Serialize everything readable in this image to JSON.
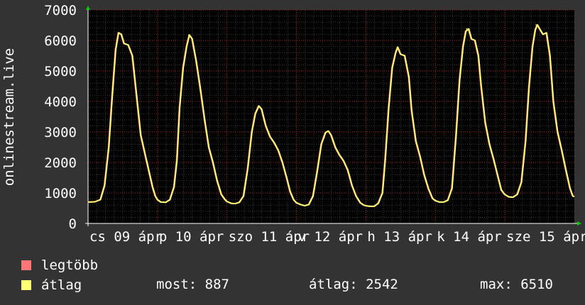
{
  "chart_data": {
    "type": "line",
    "ylabel": "onlinestream.live",
    "ylim": [
      0,
      7000
    ],
    "yticks": [
      0,
      1000,
      2000,
      3000,
      4000,
      5000,
      6000,
      7000
    ],
    "xlim": [
      0,
      7
    ],
    "xticks": [
      {
        "x": 0,
        "label": "cs 09 ápr"
      },
      {
        "x": 1,
        "label": "p 10 ápr"
      },
      {
        "x": 2,
        "label": "szo 11 ápr"
      },
      {
        "x": 3,
        "label": "v 12 ápr"
      },
      {
        "x": 4,
        "label": "h 13 ápr"
      },
      {
        "x": 5,
        "label": "k 14 ápr"
      },
      {
        "x": 6,
        "label": "sze 15 ápr"
      }
    ],
    "grid": true,
    "background": "#000000",
    "colors": {
      "max": "#ff7777",
      "avg": "#ffff77",
      "grid_major": "#9b2d2d",
      "grid_minor": "#3a3a3a",
      "arrow": "#00cc00"
    },
    "daily_peaks": [
      {
        "x": 0.45,
        "y": 6250
      },
      {
        "x": 1.45,
        "y": 6180
      },
      {
        "x": 2.45,
        "y": 3850
      },
      {
        "x": 3.45,
        "y": 3030
      },
      {
        "x": 4.45,
        "y": 5780
      },
      {
        "x": 5.45,
        "y": 6380
      },
      {
        "x": 6.45,
        "y": 6510
      }
    ],
    "series": [
      {
        "name": "legtöbb",
        "points": [
          [
            0.0,
            700
          ],
          [
            0.1,
            710
          ],
          [
            0.18,
            780
          ],
          [
            0.24,
            1250
          ],
          [
            0.3,
            2500
          ],
          [
            0.35,
            4200
          ],
          [
            0.4,
            5700
          ],
          [
            0.44,
            6250
          ],
          [
            0.48,
            6200
          ],
          [
            0.52,
            5900
          ],
          [
            0.58,
            5850
          ],
          [
            0.64,
            5500
          ],
          [
            0.7,
            4200
          ],
          [
            0.76,
            2900
          ],
          [
            0.82,
            2300
          ],
          [
            0.88,
            1700
          ],
          [
            0.93,
            1200
          ],
          [
            0.97,
            900
          ],
          [
            1.0,
            780
          ],
          [
            1.05,
            700
          ],
          [
            1.12,
            690
          ],
          [
            1.18,
            780
          ],
          [
            1.24,
            1200
          ],
          [
            1.28,
            2050
          ],
          [
            1.32,
            3800
          ],
          [
            1.37,
            5100
          ],
          [
            1.42,
            5800
          ],
          [
            1.46,
            6180
          ],
          [
            1.5,
            6050
          ],
          [
            1.56,
            5300
          ],
          [
            1.62,
            4400
          ],
          [
            1.68,
            3400
          ],
          [
            1.74,
            2500
          ],
          [
            1.8,
            2000
          ],
          [
            1.86,
            1400
          ],
          [
            1.92,
            950
          ],
          [
            1.97,
            790
          ],
          [
            2.0,
            720
          ],
          [
            2.06,
            660
          ],
          [
            2.12,
            650
          ],
          [
            2.18,
            690
          ],
          [
            2.24,
            900
          ],
          [
            2.3,
            1800
          ],
          [
            2.36,
            3000
          ],
          [
            2.41,
            3600
          ],
          [
            2.46,
            3850
          ],
          [
            2.5,
            3750
          ],
          [
            2.56,
            3200
          ],
          [
            2.62,
            2850
          ],
          [
            2.68,
            2650
          ],
          [
            2.74,
            2400
          ],
          [
            2.8,
            2000
          ],
          [
            2.86,
            1500
          ],
          [
            2.91,
            1050
          ],
          [
            2.96,
            780
          ],
          [
            3.0,
            680
          ],
          [
            3.06,
            620
          ],
          [
            3.12,
            580
          ],
          [
            3.18,
            620
          ],
          [
            3.24,
            900
          ],
          [
            3.3,
            1700
          ],
          [
            3.36,
            2600
          ],
          [
            3.42,
            2980
          ],
          [
            3.46,
            3030
          ],
          [
            3.5,
            2900
          ],
          [
            3.56,
            2500
          ],
          [
            3.62,
            2250
          ],
          [
            3.68,
            2050
          ],
          [
            3.74,
            1750
          ],
          [
            3.8,
            1250
          ],
          [
            3.86,
            900
          ],
          [
            3.92,
            680
          ],
          [
            3.97,
            600
          ],
          [
            4.0,
            580
          ],
          [
            4.06,
            560
          ],
          [
            4.12,
            560
          ],
          [
            4.18,
            660
          ],
          [
            4.24,
            1000
          ],
          [
            4.28,
            2100
          ],
          [
            4.33,
            3800
          ],
          [
            4.38,
            5100
          ],
          [
            4.43,
            5600
          ],
          [
            4.46,
            5780
          ],
          [
            4.5,
            5550
          ],
          [
            4.56,
            5500
          ],
          [
            4.62,
            4800
          ],
          [
            4.66,
            3700
          ],
          [
            4.72,
            2700
          ],
          [
            4.78,
            2200
          ],
          [
            4.84,
            1600
          ],
          [
            4.9,
            1150
          ],
          [
            4.96,
            820
          ],
          [
            5.0,
            750
          ],
          [
            5.06,
            700
          ],
          [
            5.12,
            700
          ],
          [
            5.18,
            760
          ],
          [
            5.24,
            1150
          ],
          [
            5.3,
            2900
          ],
          [
            5.35,
            4700
          ],
          [
            5.4,
            5800
          ],
          [
            5.44,
            6300
          ],
          [
            5.48,
            6380
          ],
          [
            5.52,
            6050
          ],
          [
            5.57,
            6000
          ],
          [
            5.62,
            5500
          ],
          [
            5.66,
            4500
          ],
          [
            5.72,
            3300
          ],
          [
            5.78,
            2600
          ],
          [
            5.84,
            2100
          ],
          [
            5.9,
            1550
          ],
          [
            5.95,
            1100
          ],
          [
            6.0,
            950
          ],
          [
            6.06,
            870
          ],
          [
            6.12,
            860
          ],
          [
            6.18,
            950
          ],
          [
            6.24,
            1350
          ],
          [
            6.3,
            2700
          ],
          [
            6.35,
            4500
          ],
          [
            6.4,
            5800
          ],
          [
            6.44,
            6350
          ],
          [
            6.47,
            6510
          ],
          [
            6.51,
            6350
          ],
          [
            6.55,
            6200
          ],
          [
            6.6,
            6250
          ],
          [
            6.65,
            5500
          ],
          [
            6.7,
            4000
          ],
          [
            6.76,
            3000
          ],
          [
            6.82,
            2400
          ],
          [
            6.88,
            1750
          ],
          [
            6.94,
            1150
          ],
          [
            6.98,
            900
          ],
          [
            7.0,
            880
          ]
        ]
      },
      {
        "name": "átlag",
        "points": [
          [
            0.0,
            700
          ],
          [
            0.1,
            710
          ],
          [
            0.18,
            780
          ],
          [
            0.24,
            1250
          ],
          [
            0.3,
            2500
          ],
          [
            0.35,
            4200
          ],
          [
            0.4,
            5700
          ],
          [
            0.44,
            6250
          ],
          [
            0.48,
            6200
          ],
          [
            0.52,
            5900
          ],
          [
            0.58,
            5850
          ],
          [
            0.64,
            5500
          ],
          [
            0.7,
            4200
          ],
          [
            0.76,
            2900
          ],
          [
            0.82,
            2300
          ],
          [
            0.88,
            1700
          ],
          [
            0.93,
            1200
          ],
          [
            0.97,
            900
          ],
          [
            1.0,
            780
          ],
          [
            1.05,
            700
          ],
          [
            1.12,
            690
          ],
          [
            1.18,
            780
          ],
          [
            1.24,
            1200
          ],
          [
            1.28,
            2050
          ],
          [
            1.32,
            3800
          ],
          [
            1.37,
            5100
          ],
          [
            1.42,
            5800
          ],
          [
            1.46,
            6180
          ],
          [
            1.5,
            6050
          ],
          [
            1.56,
            5300
          ],
          [
            1.62,
            4400
          ],
          [
            1.68,
            3400
          ],
          [
            1.74,
            2500
          ],
          [
            1.8,
            2000
          ],
          [
            1.86,
            1400
          ],
          [
            1.92,
            950
          ],
          [
            1.97,
            790
          ],
          [
            2.0,
            720
          ],
          [
            2.06,
            660
          ],
          [
            2.12,
            650
          ],
          [
            2.18,
            690
          ],
          [
            2.24,
            900
          ],
          [
            2.3,
            1800
          ],
          [
            2.36,
            3000
          ],
          [
            2.41,
            3600
          ],
          [
            2.46,
            3850
          ],
          [
            2.5,
            3750
          ],
          [
            2.56,
            3200
          ],
          [
            2.62,
            2850
          ],
          [
            2.68,
            2650
          ],
          [
            2.74,
            2400
          ],
          [
            2.8,
            2000
          ],
          [
            2.86,
            1500
          ],
          [
            2.91,
            1050
          ],
          [
            2.96,
            780
          ],
          [
            3.0,
            680
          ],
          [
            3.06,
            620
          ],
          [
            3.12,
            580
          ],
          [
            3.18,
            620
          ],
          [
            3.24,
            900
          ],
          [
            3.3,
            1700
          ],
          [
            3.36,
            2600
          ],
          [
            3.42,
            2980
          ],
          [
            3.46,
            3030
          ],
          [
            3.5,
            2900
          ],
          [
            3.56,
            2500
          ],
          [
            3.62,
            2250
          ],
          [
            3.68,
            2050
          ],
          [
            3.74,
            1750
          ],
          [
            3.8,
            1250
          ],
          [
            3.86,
            900
          ],
          [
            3.92,
            680
          ],
          [
            3.97,
            600
          ],
          [
            4.0,
            580
          ],
          [
            4.06,
            560
          ],
          [
            4.12,
            560
          ],
          [
            4.18,
            660
          ],
          [
            4.24,
            1000
          ],
          [
            4.28,
            2100
          ],
          [
            4.33,
            3800
          ],
          [
            4.38,
            5100
          ],
          [
            4.43,
            5600
          ],
          [
            4.46,
            5780
          ],
          [
            4.5,
            5550
          ],
          [
            4.56,
            5500
          ],
          [
            4.62,
            4800
          ],
          [
            4.66,
            3700
          ],
          [
            4.72,
            2700
          ],
          [
            4.78,
            2200
          ],
          [
            4.84,
            1600
          ],
          [
            4.9,
            1150
          ],
          [
            4.96,
            820
          ],
          [
            5.0,
            750
          ],
          [
            5.06,
            700
          ],
          [
            5.12,
            700
          ],
          [
            5.18,
            760
          ],
          [
            5.24,
            1150
          ],
          [
            5.3,
            2900
          ],
          [
            5.35,
            4700
          ],
          [
            5.4,
            5800
          ],
          [
            5.44,
            6300
          ],
          [
            5.48,
            6380
          ],
          [
            5.52,
            6050
          ],
          [
            5.57,
            6000
          ],
          [
            5.62,
            5500
          ],
          [
            5.66,
            4500
          ],
          [
            5.72,
            3300
          ],
          [
            5.78,
            2600
          ],
          [
            5.84,
            2100
          ],
          [
            5.9,
            1550
          ],
          [
            5.95,
            1100
          ],
          [
            6.0,
            950
          ],
          [
            6.06,
            870
          ],
          [
            6.12,
            860
          ],
          [
            6.18,
            950
          ],
          [
            6.24,
            1350
          ],
          [
            6.3,
            2700
          ],
          [
            6.35,
            4500
          ],
          [
            6.4,
            5800
          ],
          [
            6.44,
            6350
          ],
          [
            6.47,
            6510
          ],
          [
            6.51,
            6350
          ],
          [
            6.55,
            6200
          ],
          [
            6.6,
            6250
          ],
          [
            6.65,
            5500
          ],
          [
            6.7,
            4000
          ],
          [
            6.76,
            3000
          ],
          [
            6.82,
            2400
          ],
          [
            6.88,
            1750
          ],
          [
            6.94,
            1150
          ],
          [
            6.98,
            900
          ],
          [
            7.0,
            880
          ]
        ]
      }
    ]
  },
  "legend": {
    "max_label": "legtöbb",
    "avg_label": "átlag",
    "now_label": "most:",
    "now_value": "887",
    "avg_stat_label": "átlag:",
    "avg_stat_value": "2542",
    "max_stat_label": "max:",
    "max_stat_value": "6510"
  }
}
